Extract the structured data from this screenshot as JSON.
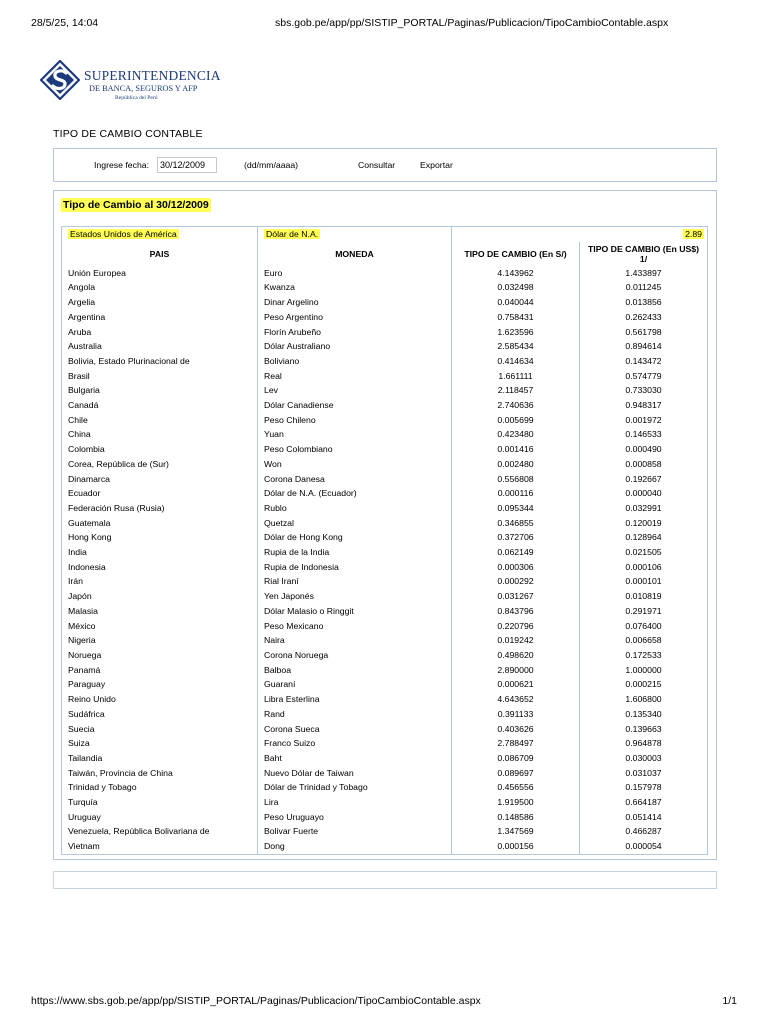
{
  "print_header": {
    "datetime": "28/5/25, 14:04",
    "url": "sbs.gob.pe/app/pp/SISTIP_PORTAL/Paginas/Publicacion/TipoCambioContable.aspx"
  },
  "logo": {
    "line1": "SUPERINTENDENCIA",
    "line2": "DE BANCA, SEGUROS Y AFP",
    "line3": "República del Perú",
    "icon": "sbs-logo-icon",
    "color": "#1d3a7b"
  },
  "page_title": "TIPO DE CAMBIO CONTABLE",
  "search": {
    "label": "Ingrese fecha:",
    "date_value": "30/12/2009",
    "format_hint": "(dd/mm/aaaa)",
    "consultar": "Consultar",
    "exportar": "Exportar"
  },
  "results": {
    "title": "Tipo de Cambio al 30/12/2009",
    "highlight_color": "#ffff55",
    "reference": {
      "pais": "Estados Unidos de América",
      "moneda": "Dólar de N.A.",
      "valor": "2.89"
    },
    "headers": {
      "pais": "PAIS",
      "moneda": "MONEDA",
      "soles": "TIPO DE CAMBIO (En S/)",
      "usd": "TIPO DE CAMBIO (En US$)",
      "usd_note": "1/"
    },
    "rows": [
      [
        "Unión Europea",
        "Euro",
        "4.143962",
        "1.433897"
      ],
      [
        "Angola",
        "Kwanza",
        "0.032498",
        "0.011245"
      ],
      [
        "Argelia",
        "Dinar Argelino",
        "0.040044",
        "0.013856"
      ],
      [
        "Argentina",
        "Peso Argentino",
        "0.758431",
        "0.262433"
      ],
      [
        "Aruba",
        "Florín Arubeño",
        "1.623596",
        "0.561798"
      ],
      [
        "Australia",
        "Dólar Australiano",
        "2.585434",
        "0.894614"
      ],
      [
        "Bolivia, Estado Plurinacional de",
        "Boliviano",
        "0.414634",
        "0.143472"
      ],
      [
        "Brasil",
        "Real",
        "1.661111",
        "0.574779"
      ],
      [
        "Bulgaria",
        "Lev",
        "2.118457",
        "0.733030"
      ],
      [
        "Canadá",
        "Dólar Canadiense",
        "2.740636",
        "0.948317"
      ],
      [
        "Chile",
        "Peso Chileno",
        "0.005699",
        "0.001972"
      ],
      [
        "China",
        "Yuan",
        "0.423480",
        "0.146533"
      ],
      [
        "Colombia",
        "Peso Colombiano",
        "0.001416",
        "0.000490"
      ],
      [
        "Corea, República de (Sur)",
        "Won",
        "0.002480",
        "0.000858"
      ],
      [
        "Dinamarca",
        "Corona Danesa",
        "0.556808",
        "0.192667"
      ],
      [
        "Ecuador",
        "Dólar de N.A. (Ecuador)",
        "0.000116",
        "0.000040"
      ],
      [
        "Federación Rusa (Rusia)",
        "Rublo",
        "0.095344",
        "0.032991"
      ],
      [
        "Guatemala",
        "Quetzal",
        "0.346855",
        "0.120019"
      ],
      [
        "Hong Kong",
        "Dólar de Hong Kong",
        "0.372706",
        "0.128964"
      ],
      [
        "India",
        "Rupia de la India",
        "0.062149",
        "0.021505"
      ],
      [
        "Indonesia",
        "Rupia de Indonesia",
        "0.000306",
        "0.000106"
      ],
      [
        "Irán",
        "Rial Iraní",
        "0.000292",
        "0.000101"
      ],
      [
        "Japón",
        "Yen Japonés",
        "0.031267",
        "0.010819"
      ],
      [
        "Malasia",
        "Dólar Malasio o Ringgit",
        "0.843796",
        "0.291971"
      ],
      [
        "México",
        "Peso Mexicano",
        "0.220796",
        "0.076400"
      ],
      [
        "Nigeria",
        "Naira",
        "0.019242",
        "0.006658"
      ],
      [
        "Noruega",
        "Corona Noruega",
        "0.498620",
        "0.172533"
      ],
      [
        "Panamá",
        "Balboa",
        "2.890000",
        "1.000000"
      ],
      [
        "Paraguay",
        "Guaraní",
        "0.000621",
        "0.000215"
      ],
      [
        "Reino Unido",
        "Libra Esterlina",
        "4.643652",
        "1.606800"
      ],
      [
        "Sudáfrica",
        "Rand",
        "0.391133",
        "0.135340"
      ],
      [
        "Suecia",
        "Corona Sueca",
        "0.403626",
        "0.139663"
      ],
      [
        "Suiza",
        "Franco Suizo",
        "2.788497",
        "0.964878"
      ],
      [
        "Tailandia",
        "Baht",
        "0.086709",
        "0.030003"
      ],
      [
        "Taiwán, Provincia de China",
        "Nuevo Dólar de Taiwan",
        "0.089697",
        "0.031037"
      ],
      [
        "Trinidad y Tobago",
        "Dólar de Trinidad y Tobago",
        "0.456556",
        "0.157978"
      ],
      [
        "Turquía",
        "Lira",
        "1.919500",
        "0.664187"
      ],
      [
        "Uruguay",
        "Peso Uruguayo",
        "0.148586",
        "0.051414"
      ],
      [
        "Venezuela, República Bolivariana de",
        "Bolivar Fuerte",
        "1.347569",
        "0.466287"
      ],
      [
        "Vietnam",
        "Dong",
        "0.000156",
        "0.000054"
      ]
    ]
  },
  "print_footer": {
    "url": "https://www.sbs.gob.pe/app/pp/SISTIP_PORTAL/Paginas/Publicacion/TipoCambioContable.aspx",
    "pages": "1/1"
  }
}
